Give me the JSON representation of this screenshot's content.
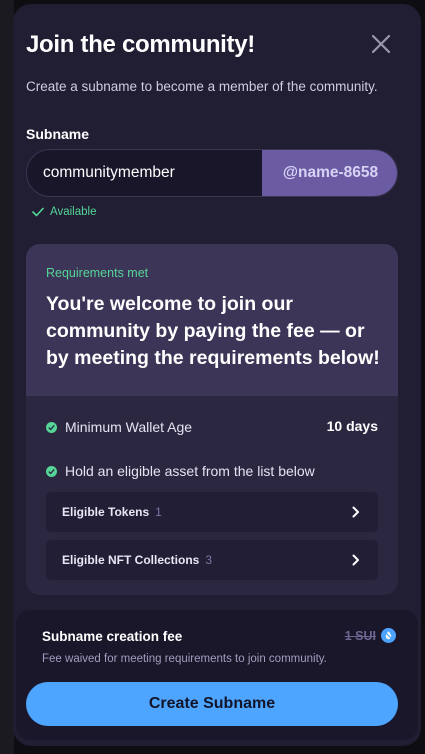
{
  "modal": {
    "title": "Join the community!",
    "subtitle": "Create a subname to become a member of the community."
  },
  "subname": {
    "label": "Subname",
    "value": "communitymember",
    "suffix": "@name-8658",
    "status": "Available"
  },
  "requirements": {
    "status": "Requirements met",
    "message": "You're welcome to join our community by paying the fee — or by meeting the requirements below!",
    "items": [
      {
        "label": "Minimum Wallet Age",
        "value": "10 days"
      },
      {
        "label": "Hold an eligible asset from the list below"
      }
    ],
    "lists": [
      {
        "label": "Eligible Tokens",
        "count": "1"
      },
      {
        "label": "Eligible NFT Collections",
        "count": "3"
      }
    ]
  },
  "fee": {
    "title": "Subname creation fee",
    "amount": "1 SUI",
    "note": "Fee waived for meeting requirements to join community."
  },
  "actions": {
    "create_label": "Create Subname"
  },
  "colors": {
    "accent": "#4ea5ff",
    "success": "#55d597",
    "suffix_bg": "#6b5ba3",
    "modal_bg": "#211d33"
  },
  "icons": {
    "close": "close-icon",
    "check": "check-icon",
    "chevron": "chevron-right-icon",
    "sui": "sui-icon"
  }
}
